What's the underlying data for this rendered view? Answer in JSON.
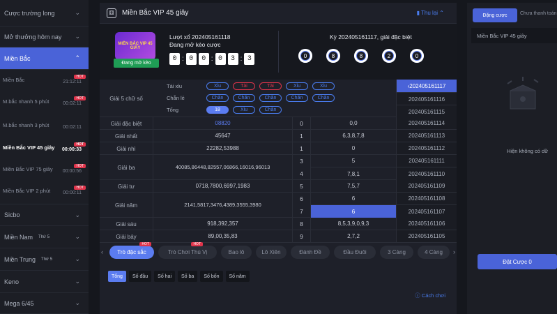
{
  "sidebar": {
    "items": [
      {
        "label": "Cược trường long"
      },
      {
        "label": "Mở thưởng hôm nay"
      },
      {
        "label": "Miền Bắc"
      },
      {
        "label": "Sicbo"
      },
      {
        "label": "Miền Nam",
        "extra": "Thứ 5"
      },
      {
        "label": "Miền Trung",
        "extra": "Thứ 5"
      },
      {
        "label": "Keno"
      },
      {
        "label": "Mega 6/45"
      }
    ],
    "sub": [
      {
        "label": "Miền Bắc",
        "time": "21:12:11",
        "hot": "HOT"
      },
      {
        "label": "M.bắc nhanh 5 phút",
        "time": "00:02:11",
        "hot": "HOT"
      },
      {
        "label": "M.bắc nhanh 3 phút",
        "time": "00:02:11",
        "hot": ""
      },
      {
        "label": "Miền Bắc VIP 45 giây",
        "time": "00:00:33",
        "hot": "HOT"
      },
      {
        "label": "Miền Bắc VIP 75 giây",
        "time": "00:00:56",
        "hot": "HOT"
      },
      {
        "label": "Miền Bắc VIP 2 phút",
        "time": "00:00:11",
        "hot": "HOT"
      }
    ]
  },
  "header": {
    "title": "Miền Bắc VIP 45 giây",
    "back": "Thu lại"
  },
  "info": {
    "badge": "MIỀN BẮC VIP 45 GIÂY",
    "status_button": "Đang mở kèo",
    "draw": "Lượt xổ 202405161118",
    "open": "Đang mở kèo cược",
    "timer": [
      "0",
      "0",
      "0",
      "0",
      "3",
      "3"
    ],
    "period": "Kỳ 202405161117, giải đặc biệt",
    "balls": [
      "0",
      "8",
      "8",
      "2",
      "0"
    ]
  },
  "stats": {
    "label": "Giải 5 chữ số",
    "taixiu_label": "Tài xỉu",
    "taixiu": [
      {
        "t": "Xỉu",
        "c": "blue"
      },
      {
        "t": "Tài",
        "c": "red"
      },
      {
        "t": "Tài",
        "c": "red"
      },
      {
        "t": "Xỉu",
        "c": "blue"
      },
      {
        "t": "Xỉu",
        "c": "blue"
      }
    ],
    "chanle_label": "Chẵn lẻ",
    "chanle": [
      "Chẵn",
      "Chẵn",
      "Chẵn",
      "Chẵn",
      "Chẵn"
    ],
    "tong_label": "Tổng",
    "tong": [
      "18",
      "Xỉu",
      "Chẵn"
    ]
  },
  "results": [
    {
      "name": "Giải đặc biệt",
      "value": "08820",
      "d": "0",
      "tail": "0,0",
      "period": "202405161114"
    },
    {
      "name": "Giải nhất",
      "value": "45647",
      "d": "1",
      "tail": "6,3,8,7,8",
      "period": "202405161113"
    },
    {
      "name": "Giải nhì",
      "value": "22282,53988",
      "d": "1",
      "tail": "0",
      "period": "202405161112"
    },
    {
      "name": "Giải ba",
      "value": "40085,86448,82557,06866,16016,96013",
      "d": "3",
      "tail": "5",
      "period": "202405161111"
    },
    {
      "name": "",
      "value": "",
      "d": "4",
      "tail": "7,8,1",
      "period": "202405161110"
    },
    {
      "name": "Giải tư",
      "value": "0718,7800,6997,1983",
      "d": "5",
      "tail": "7,5,7",
      "period": "202405161109"
    },
    {
      "name": "Giải năm",
      "value": "2141,5817,3476,4389,3555,3980",
      "d": "6",
      "tail": "6",
      "period": "202405161108"
    },
    {
      "name": "",
      "value": "",
      "d": "7",
      "tail": "6",
      "period": "202405161107"
    },
    {
      "name": "Giải sáu",
      "value": "918,392,357",
      "d": "8",
      "tail": "8,5,3,9,0,9,3",
      "period": "202405161106"
    },
    {
      "name": "Giải bảy",
      "value": "89,00,35,83",
      "d": "9",
      "tail": "2,7,2",
      "period": "202405161105"
    }
  ],
  "period_head": "202405161117",
  "period_extra": [
    "202405161116",
    "202405161115"
  ],
  "tabs": [
    "Trò đặc sắc",
    "Trò Chơi Thú Vị",
    "Bao lô",
    "Lô Xiên",
    "Đánh Đề",
    "Đầu Đuôi",
    "3 Càng",
    "4 Càng"
  ],
  "tab_hot": "HOT",
  "subtabs": [
    "Tổng",
    "Số đầu",
    "Số hai",
    "Số ba",
    "Số bốn",
    "Số năm"
  ],
  "cachchoi": "Cách chơi",
  "right": {
    "tab1": "Đặng cược",
    "tab2": "Chưa thanh toán",
    "game": "Miền Bắc VIP 45 giây",
    "empty": "Hiện không có dữ",
    "bet_button": "Đặt Cược 0"
  }
}
